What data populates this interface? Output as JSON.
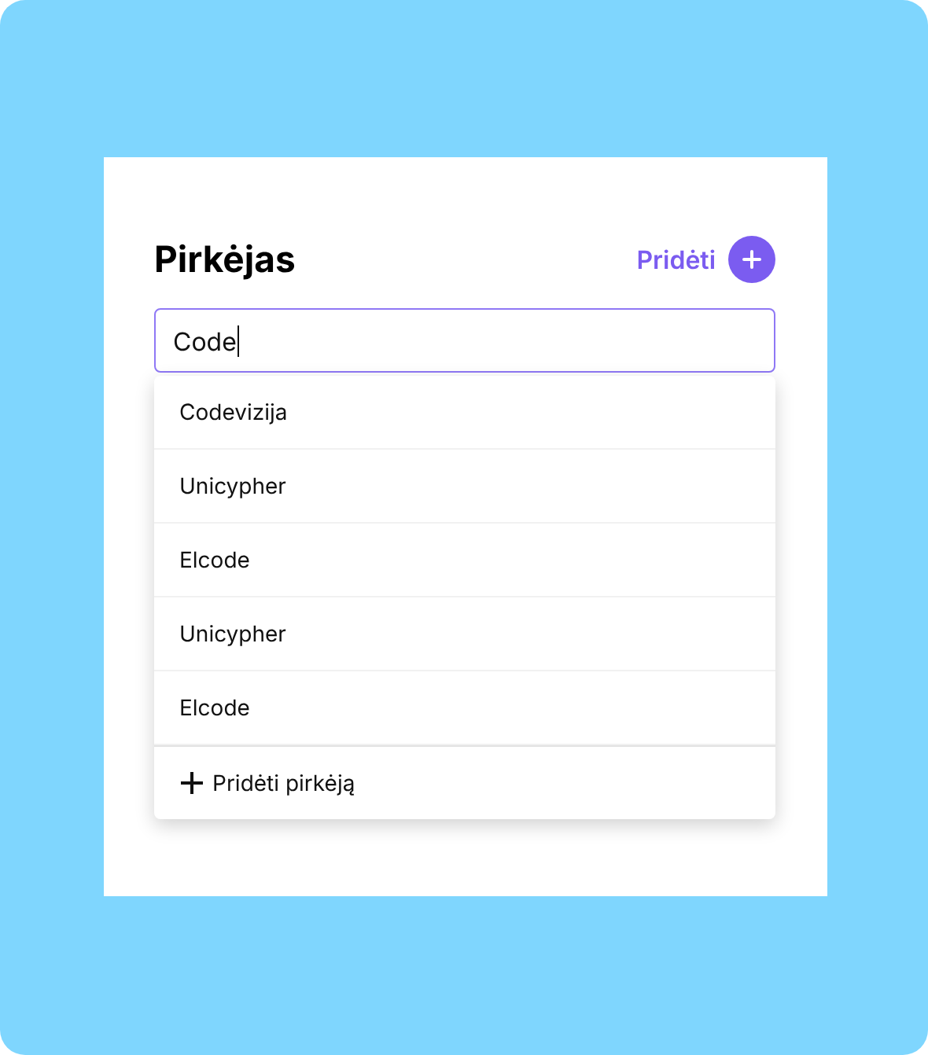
{
  "title": "Pirkėjas",
  "add_button": {
    "label": "Pridėti"
  },
  "search": {
    "value": "Code"
  },
  "suggestions": [
    {
      "label": "Codevizija"
    },
    {
      "label": "Unicypher"
    },
    {
      "label": "Elcode"
    },
    {
      "label": "Unicypher"
    },
    {
      "label": "Elcode"
    }
  ],
  "add_buyer": {
    "label": "Pridėti pirkėją"
  }
}
